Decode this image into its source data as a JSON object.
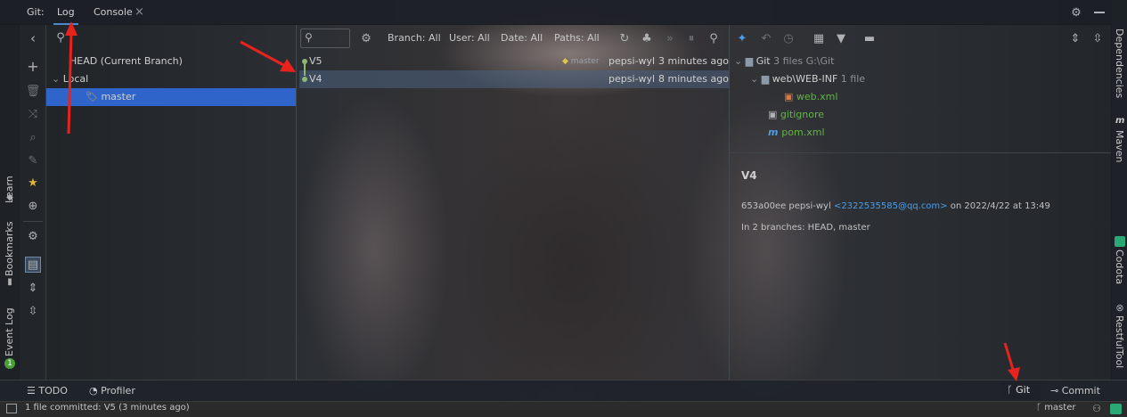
{
  "top": {
    "git_label": "Git:",
    "tab_log": "Log",
    "tab_console": "Console",
    "tab_close": "×"
  },
  "left_strip": {
    "learn": "Learn",
    "bookmarks": "Bookmarks",
    "event_log": "Event Log",
    "event_badge": "1"
  },
  "right_strip": {
    "dependencies": "Dependencies",
    "maven": "Maven",
    "codota": "Codota",
    "restful": "RestfulTool"
  },
  "branches": {
    "search_icon": "search-icon",
    "head": "HEAD (Current Branch)",
    "local": "Local",
    "master": "master"
  },
  "filters": {
    "branch": "Branch: All",
    "user": "User: All",
    "date": "Date: All",
    "paths": "Paths: All"
  },
  "commits": [
    {
      "msg": "V5",
      "tag": "master",
      "author": "pepsi-wyl",
      "time": "3 minutes ago"
    },
    {
      "msg": "V4",
      "author": "pepsi-wyl",
      "time": "8 minutes ago"
    }
  ],
  "changes": {
    "root": "Git",
    "root_count": "3 files",
    "root_path": "G:\\Git",
    "dir": "web\\WEB-INF",
    "dir_count": "1 file",
    "files": [
      "web.xml",
      "gitignore",
      "pom.xml"
    ]
  },
  "details": {
    "title": "V4",
    "hash_author": "653a00ee pepsi-wyl",
    "email": "<2322535585@qq.com>",
    "date": "on 2022/4/22 at 13:49",
    "branches": "In 2 branches: HEAD, master"
  },
  "bottom": {
    "todo": "TODO",
    "profiler": "Profiler",
    "git": "Git",
    "commit": "Commit"
  },
  "status": {
    "message": "1 file committed: V5 (3 minutes ago)",
    "branch": "master"
  },
  "colors": {
    "accent": "#4a88c7",
    "green": "#62b543",
    "selection": "#2f65ca",
    "link": "#4a9ee8",
    "arrow": "#e8231e"
  }
}
